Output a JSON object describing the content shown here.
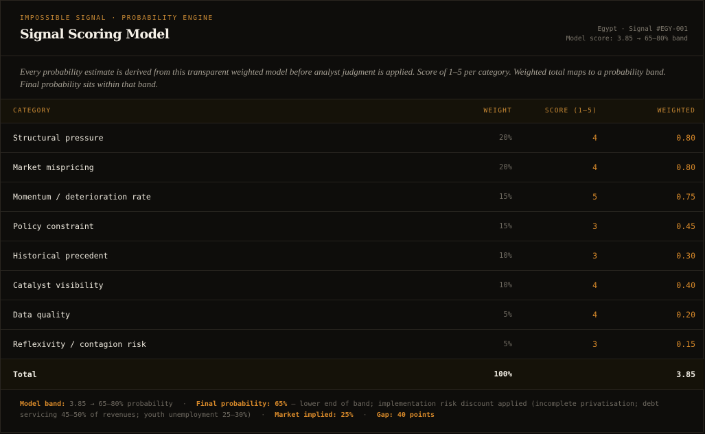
{
  "header": {
    "kicker": "IMPOSSIBLE SIGNAL · PROBABILITY ENGINE",
    "title": "Signal Scoring Model",
    "meta_line1": "Egypt · Signal #EGY-001",
    "meta_line2": "Model score: 3.85 → 65–80% band"
  },
  "description": "Every probability estimate is derived from this transparent weighted model before analyst judgment is applied. Score of 1–5 per category. Weighted total maps to a probability band. Final probability sits within that band.",
  "table": {
    "columns": {
      "category": "CATEGORY",
      "weight": "WEIGHT",
      "score": "SCORE (1–5)",
      "weighted": "WEIGHTED"
    },
    "rows": [
      {
        "category": "Structural pressure",
        "weight": "20%",
        "score": "4",
        "weighted": "0.80"
      },
      {
        "category": "Market mispricing",
        "weight": "20%",
        "score": "4",
        "weighted": "0.80"
      },
      {
        "category": "Momentum / deterioration rate",
        "weight": "15%",
        "score": "5",
        "weighted": "0.75"
      },
      {
        "category": "Policy constraint",
        "weight": "15%",
        "score": "3",
        "weighted": "0.45"
      },
      {
        "category": "Historical precedent",
        "weight": "10%",
        "score": "3",
        "weighted": "0.30"
      },
      {
        "category": "Catalyst visibility",
        "weight": "10%",
        "score": "4",
        "weighted": "0.40"
      },
      {
        "category": "Data quality",
        "weight": "5%",
        "score": "4",
        "weighted": "0.20"
      },
      {
        "category": "Reflexivity / contagion risk",
        "weight": "5%",
        "score": "3",
        "weighted": "0.15"
      }
    ],
    "total": {
      "label": "Total",
      "weight": "100%",
      "score": "",
      "weighted": "3.85"
    }
  },
  "footer": {
    "model_band_label": "Model band:",
    "model_band_value": "3.85 → 65–80% probability",
    "separator": "·",
    "final_label": "Final probability: 65%",
    "final_note": "— lower end of band; implementation risk discount applied (incomplete privatisation; debt servicing 45–50% of revenues; youth unemployment 25–30%)",
    "market_label": "Market implied: 25%",
    "gap_label": "Gap: 40 points"
  }
}
